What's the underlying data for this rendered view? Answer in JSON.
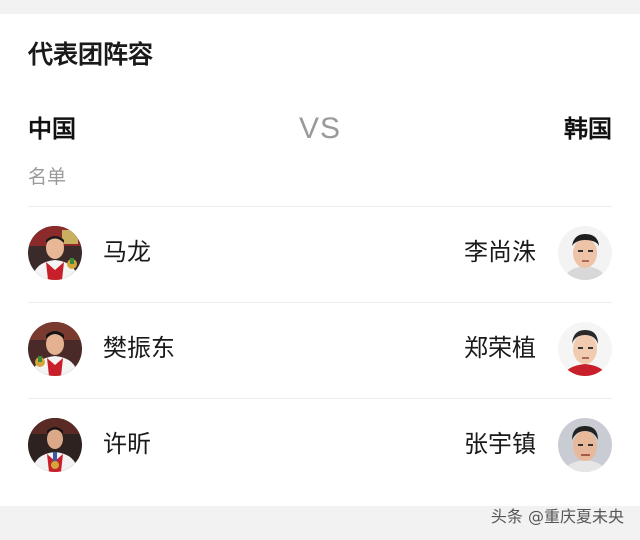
{
  "lineup": {
    "title": "代表团阵容",
    "team_home": "中国",
    "vs": "VS",
    "team_away": "韩国",
    "list_label": "名单",
    "rows": [
      {
        "home_player": "马龙",
        "away_player": "李尚洙"
      },
      {
        "home_player": "樊振东",
        "away_player": "郑荣植"
      },
      {
        "home_player": "许昕",
        "away_player": "张宇镇"
      }
    ]
  },
  "watermark": "头条 @重庆夏未央",
  "colors": {
    "card_background": "#ffffff",
    "page_background": "#f2f2f2",
    "muted_text": "#9a9a9a",
    "home_jersey_red": "#c8202a"
  }
}
